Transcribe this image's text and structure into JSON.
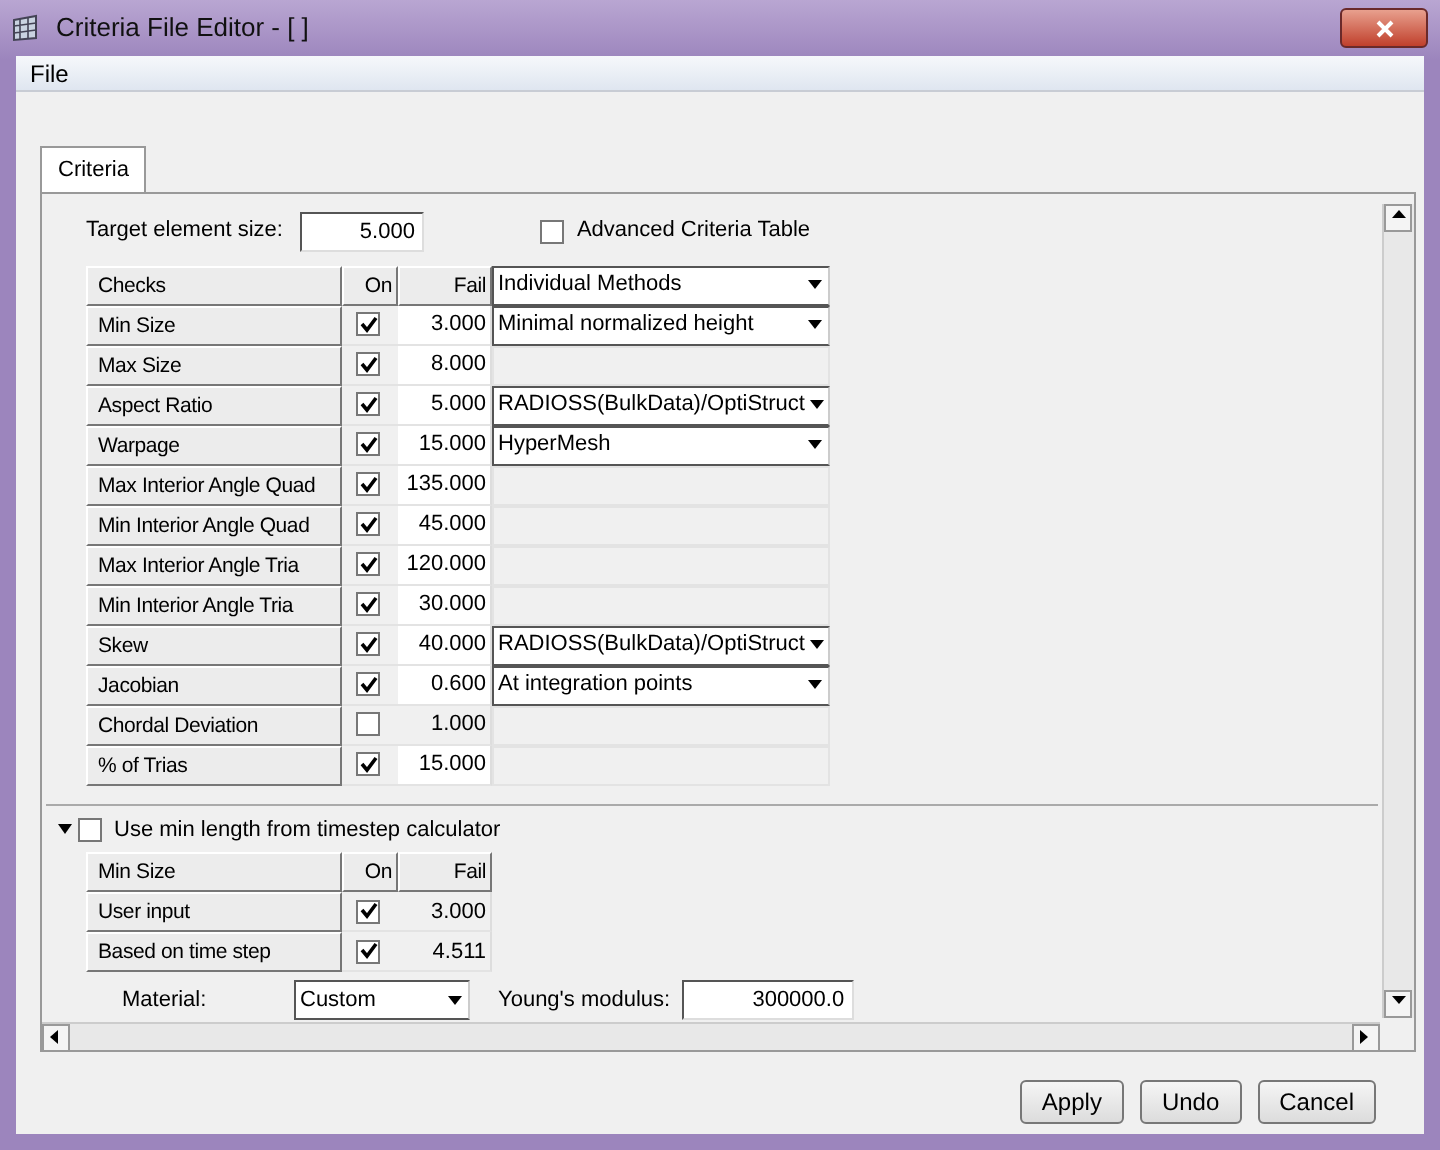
{
  "window": {
    "title": "Criteria File Editor - [ ]"
  },
  "menu": [
    "File"
  ],
  "tabs": [
    {
      "label": "Criteria",
      "selected": true
    }
  ],
  "target": {
    "label": "Target element size:",
    "value": "5.000"
  },
  "advanced": {
    "label": "Advanced Criteria Table",
    "checked": false
  },
  "checks": {
    "columns": [
      "Checks",
      "On",
      "Fail"
    ],
    "method": "Individual Methods",
    "rows": [
      {
        "name": "Min Size",
        "on": true,
        "fail": "3.000",
        "method": "Minimal normalized height"
      },
      {
        "name": "Max Size",
        "on": true,
        "fail": "8.000"
      },
      {
        "name": "Aspect Ratio",
        "on": true,
        "fail": "5.000",
        "method": "RADIOSS(BulkData)/OptiStruct"
      },
      {
        "name": "Warpage",
        "on": true,
        "fail": "15.000",
        "method": "HyperMesh"
      },
      {
        "name": "Max Interior Angle Quad",
        "on": true,
        "fail": "135.000"
      },
      {
        "name": "Min Interior Angle Quad",
        "on": true,
        "fail": "45.000"
      },
      {
        "name": "Max Interior Angle Tria",
        "on": true,
        "fail": "120.000"
      },
      {
        "name": "Min Interior Angle Tria",
        "on": true,
        "fail": "30.000"
      },
      {
        "name": "Skew",
        "on": true,
        "fail": "40.000",
        "method": "RADIOSS(BulkData)/OptiStruct"
      },
      {
        "name": "Jacobian",
        "on": true,
        "fail": "0.600",
        "method": "At integration points"
      },
      {
        "name": "Chordal Deviation",
        "on": false,
        "fail": "1.000"
      },
      {
        "name": "% of Trias",
        "on": true,
        "fail": "15.000"
      }
    ]
  },
  "timestep": {
    "expanded": true,
    "checked": false,
    "label": "Use min length from timestep calculator",
    "columns": [
      "Min Size",
      "On",
      "Fail"
    ],
    "rows": [
      {
        "name": "User input",
        "on": true,
        "fail": "3.000"
      },
      {
        "name": "Based on time step",
        "on": true,
        "fail": "4.511"
      }
    ]
  },
  "material": {
    "label": "Material:",
    "value": "Custom"
  },
  "youngs": {
    "label": "Young's modulus:",
    "value": "300000.0"
  },
  "buttons": [
    "Apply",
    "Undo",
    "Cancel"
  ]
}
